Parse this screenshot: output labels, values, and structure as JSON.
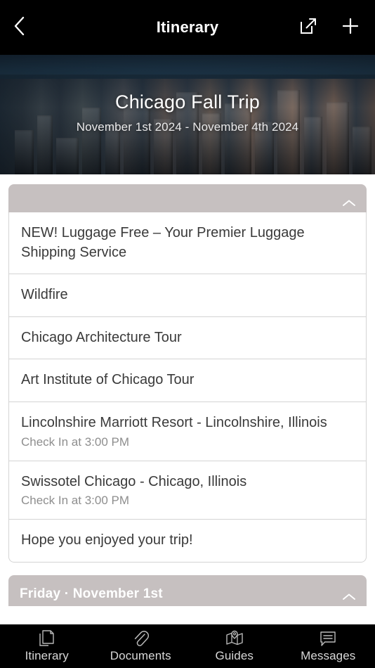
{
  "navbar": {
    "back_icon": "chevron-left-icon",
    "title": "Itinerary",
    "share_icon": "external-link-icon",
    "add_icon": "plus-icon"
  },
  "hero": {
    "image_description": "Aerial photo of the Chicago downtown skyline at dusk",
    "title": "Chicago Fall Trip",
    "date_range": "November 1st 2024 - November 4th 2024"
  },
  "cards": [
    {
      "header_title": "",
      "collapse_icon": "chevron-up-icon",
      "rows": [
        {
          "title": "NEW! Luggage Free – Your Premier Luggage Shipping Service",
          "sub": ""
        },
        {
          "title": "Wildfire",
          "sub": ""
        },
        {
          "title": "Chicago Architecture Tour",
          "sub": ""
        },
        {
          "title": "Art Institute of Chicago Tour",
          "sub": ""
        },
        {
          "title": "Lincolnshire Marriott Resort - Lincolnshire, Illinois",
          "sub": "Check In at 3:00 PM"
        },
        {
          "title": "Swissotel Chicago - Chicago, Illinois",
          "sub": "Check In at 3:00 PM"
        },
        {
          "title": "Hope you enjoyed your trip!",
          "sub": ""
        }
      ]
    },
    {
      "header_title": "Friday · November 1st",
      "collapse_icon": "chevron-up-icon",
      "rows": []
    }
  ],
  "tabbar": {
    "items": [
      {
        "label": "Itinerary",
        "icon": "documents-stack-icon"
      },
      {
        "label": "Documents",
        "icon": "paperclip-icon"
      },
      {
        "label": "Guides",
        "icon": "map-pin-icon"
      },
      {
        "label": "Messages",
        "icon": "message-bubble-icon"
      }
    ]
  },
  "colors": {
    "nav_background": "#000000",
    "card_header": "#c6c0c0",
    "card_border": "#d4d4d4",
    "row_title_text": "#3a3a3a",
    "row_sub_text": "#8e8e8e",
    "tab_label_text": "#d8d8d8",
    "page_background": "#ffffff"
  }
}
